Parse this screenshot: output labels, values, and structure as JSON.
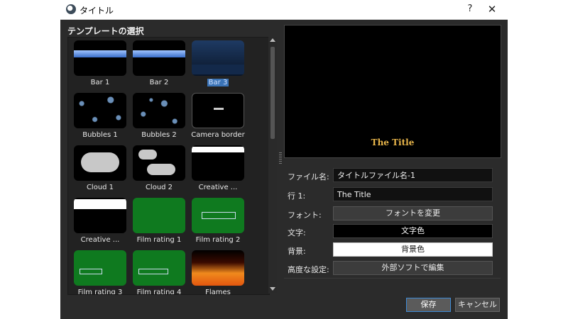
{
  "window": {
    "title": "タイトル",
    "help": "?",
    "close": "✕"
  },
  "templates": {
    "heading": "テンプレートの選択",
    "items": [
      {
        "name": "Bar 1"
      },
      {
        "name": "Bar 2"
      },
      {
        "name": "Bar 3",
        "selected": true
      },
      {
        "name": "Bubbles 1"
      },
      {
        "name": "Bubbles 2"
      },
      {
        "name": "Camera border"
      },
      {
        "name": "Cloud 1"
      },
      {
        "name": "Cloud 2"
      },
      {
        "name": "Creative ..."
      },
      {
        "name": "Creative ..."
      },
      {
        "name": "Film rating 1"
      },
      {
        "name": "Film rating 2"
      },
      {
        "name": "Film rating 3"
      },
      {
        "name": "Film rating 4"
      },
      {
        "name": "Flames"
      }
    ]
  },
  "preview": {
    "title_text": "The Title",
    "title_color": "#e8b54a"
  },
  "form": {
    "filename_label": "ファイル名:",
    "filename_value": "タイトルファイル名-1",
    "line1_label": "行 1:",
    "line1_value": "The Title",
    "font_label": "フォント:",
    "font_button": "フォントを変更",
    "text_color_label": "文字:",
    "text_color_button": "文字色",
    "bg_label": "背景:",
    "bg_button": "背景色",
    "advanced_label": "高度な設定:",
    "advanced_button": "外部ソフトで編集"
  },
  "buttons": {
    "save": "保存",
    "cancel": "キャンセル"
  },
  "colors": {
    "accent": "#3b74b7",
    "dialog_bg": "#2b2b2b"
  }
}
